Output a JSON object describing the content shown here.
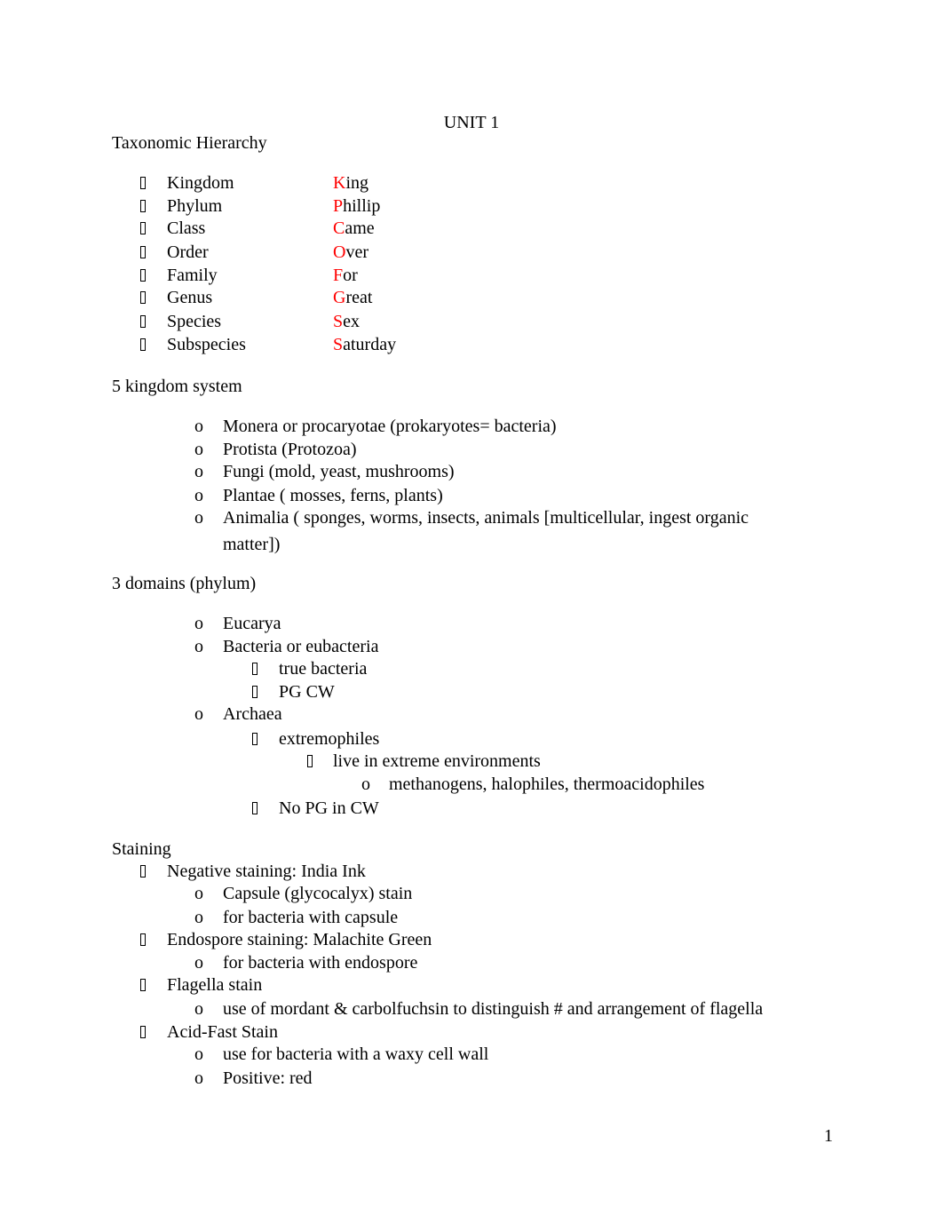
{
  "document": {
    "title": "UNIT 1",
    "page_number": "1",
    "sections": {
      "taxonomy": {
        "heading": "Taxonomic Hierarchy",
        "rows": [
          {
            "rank": "Kingdom",
            "mnemonic_first": "K",
            "mnemonic_rest": "ing"
          },
          {
            "rank": "Phylum",
            "mnemonic_first": "P",
            "mnemonic_rest": "hillip"
          },
          {
            "rank": "Class",
            "mnemonic_first": "C",
            "mnemonic_rest": "ame"
          },
          {
            "rank": "Order",
            "mnemonic_first": "O",
            "mnemonic_rest": "ver"
          },
          {
            "rank": "Family",
            "mnemonic_first": "F",
            "mnemonic_rest": "or"
          },
          {
            "rank": "Genus",
            "mnemonic_first": "G",
            "mnemonic_rest": "reat"
          },
          {
            "rank": "Species",
            "mnemonic_first": "S",
            "mnemonic_rest": "ex"
          },
          {
            "rank": "Subspecies",
            "mnemonic_first": "S",
            "mnemonic_rest": "aturday"
          }
        ],
        "mnemonic_color": "#ff0000"
      },
      "kingdoms": {
        "heading": "5 kingdom system",
        "items": [
          "Monera or procaryotae (prokaryotes= bacteria)",
          "Protista (Protozoa)",
          "Fungi (mold, yeast, mushrooms)",
          "Plantae ( mosses, ferns, plants)",
          "Animalia ( sponges, worms, insects, animals [multicellular, ingest organic",
          "matter])"
        ]
      },
      "domains": {
        "heading": "3 domains (phylum)",
        "items": [
          "Eucarya",
          "Bacteria or eubacteria",
          "true bacteria",
          "PG CW",
          "Archaea",
          "extremophiles",
          "live in extreme environments",
          "methanogens, halophiles, thermoacidophiles",
          "No PG in CW"
        ]
      },
      "staining": {
        "heading": "Staining",
        "items": [
          "Negative staining: India Ink",
          "Capsule (glycocalyx) stain",
          "for bacteria with capsule",
          "Endospore staining: Malachite Green",
          "for bacteria with endospore",
          "Flagella stain",
          "use of mordant & carbolfuchsin to distinguish # and arrangement of flagella",
          "Acid-Fast Stain",
          "use for bacteria with a waxy cell wall",
          "Positive: red"
        ]
      }
    },
    "bullets": {
      "square": "missing-glyph-bullet",
      "circle": "o"
    }
  }
}
